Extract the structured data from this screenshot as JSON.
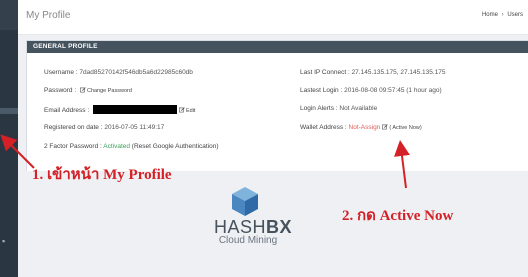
{
  "header": {
    "title": "My Profile",
    "breadcrumb": [
      "Home",
      "›",
      "Users"
    ]
  },
  "panel": {
    "title": "GENERAL PROFILE",
    "left": {
      "username_label": "Username : ",
      "username_value": "7dad85270142f546db5a6d22985c60db",
      "password_label": "Password : ",
      "password_link": "Change Password",
      "email_label": "Email Address : ",
      "email_link": "Edit",
      "registered_label": "Registered on date : ",
      "registered_value": "2016-07-05 11:49:17",
      "twofactor_label": "2 Factor Password : ",
      "twofactor_status": "Activated",
      "twofactor_reset": " (Reset Google Authentication)"
    },
    "right": {
      "ip_label": "Last IP Connect : ",
      "ip_value": "27.145.135.175, 27.145.135.175",
      "login_label": "Lastest Login : ",
      "login_value": "2016-08-08 09:57:45 (1 hour ago)",
      "alerts_label": "Login Alerts : ",
      "alerts_value": "Not Available",
      "wallet_label": "Wallet Address : ",
      "wallet_status": "Not-Assign",
      "wallet_link": "( Active Now)"
    }
  },
  "logo": {
    "brand_prefix": "HASH",
    "brand_suffix": "BX",
    "tagline": "Cloud Mining"
  },
  "annotations": {
    "step1": "1. เข้าหน้า My Profile",
    "step2": "2. กด Active Now"
  },
  "colors": {
    "panel_header_bg": "#45535f",
    "activated": "#3aa35b",
    "not_assign": "#e35b5a",
    "annotation": "#d42027"
  }
}
